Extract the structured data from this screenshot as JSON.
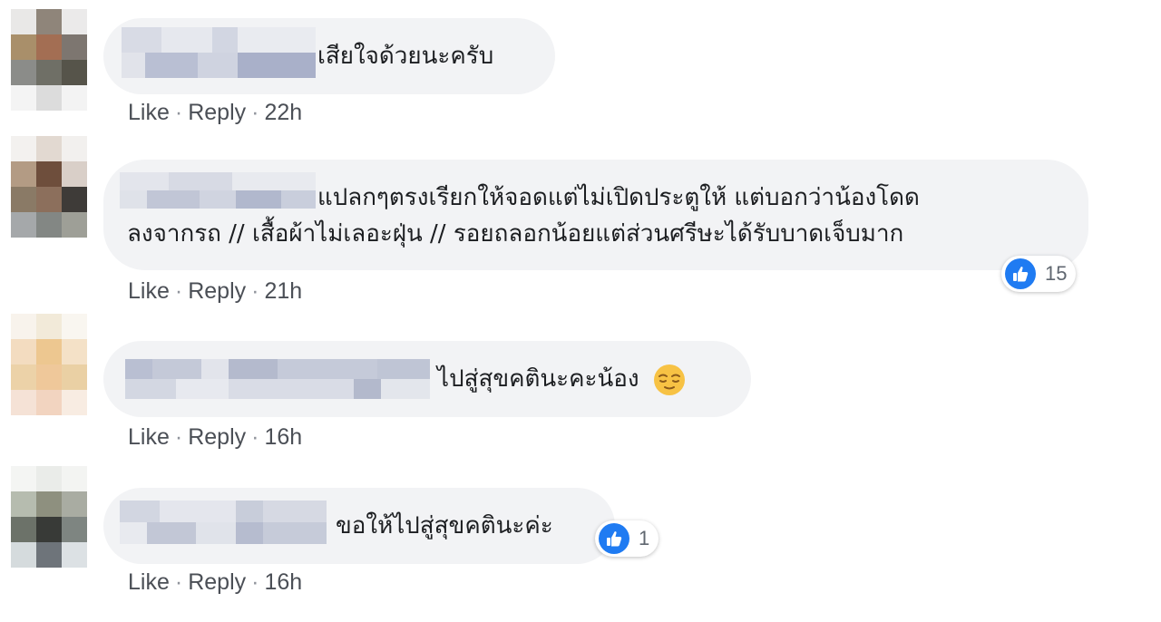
{
  "comments": [
    {
      "text_lines": [
        "เสียใจด้วยนะครับ"
      ],
      "like": "Like",
      "reply": "Reply",
      "time": "22h"
    },
    {
      "text_lines": [
        "แปลกๆตรงเรียกให้จอดแต่ไม่เปิดประตูให้ แต่บอกว่าน้องโดด",
        "ลงจากรถ // เสื้อผ้าไม่เลอะฝุ่น // รอยถลอกน้อยแต่ส่วนศรีษะได้รับบาดเจ็บมาก"
      ],
      "like": "Like",
      "reply": "Reply",
      "time": "21h",
      "reactions": "15"
    },
    {
      "text_lines": [
        "ไปสู่สุขคตินะคะน้อง"
      ],
      "like": "Like",
      "reply": "Reply",
      "time": "16h",
      "emoji": "relieved-face-icon"
    },
    {
      "text_lines": [
        "ขอให้ไปสู่สุขคตินะค่ะ"
      ],
      "like": "Like",
      "reply": "Reply",
      "time": "16h",
      "reactions": "1"
    }
  ],
  "separator": "·",
  "colors": {
    "bubble": "#f2f3f5",
    "like_blue": "#1f7bf2",
    "action_text": "#4b4f56"
  }
}
